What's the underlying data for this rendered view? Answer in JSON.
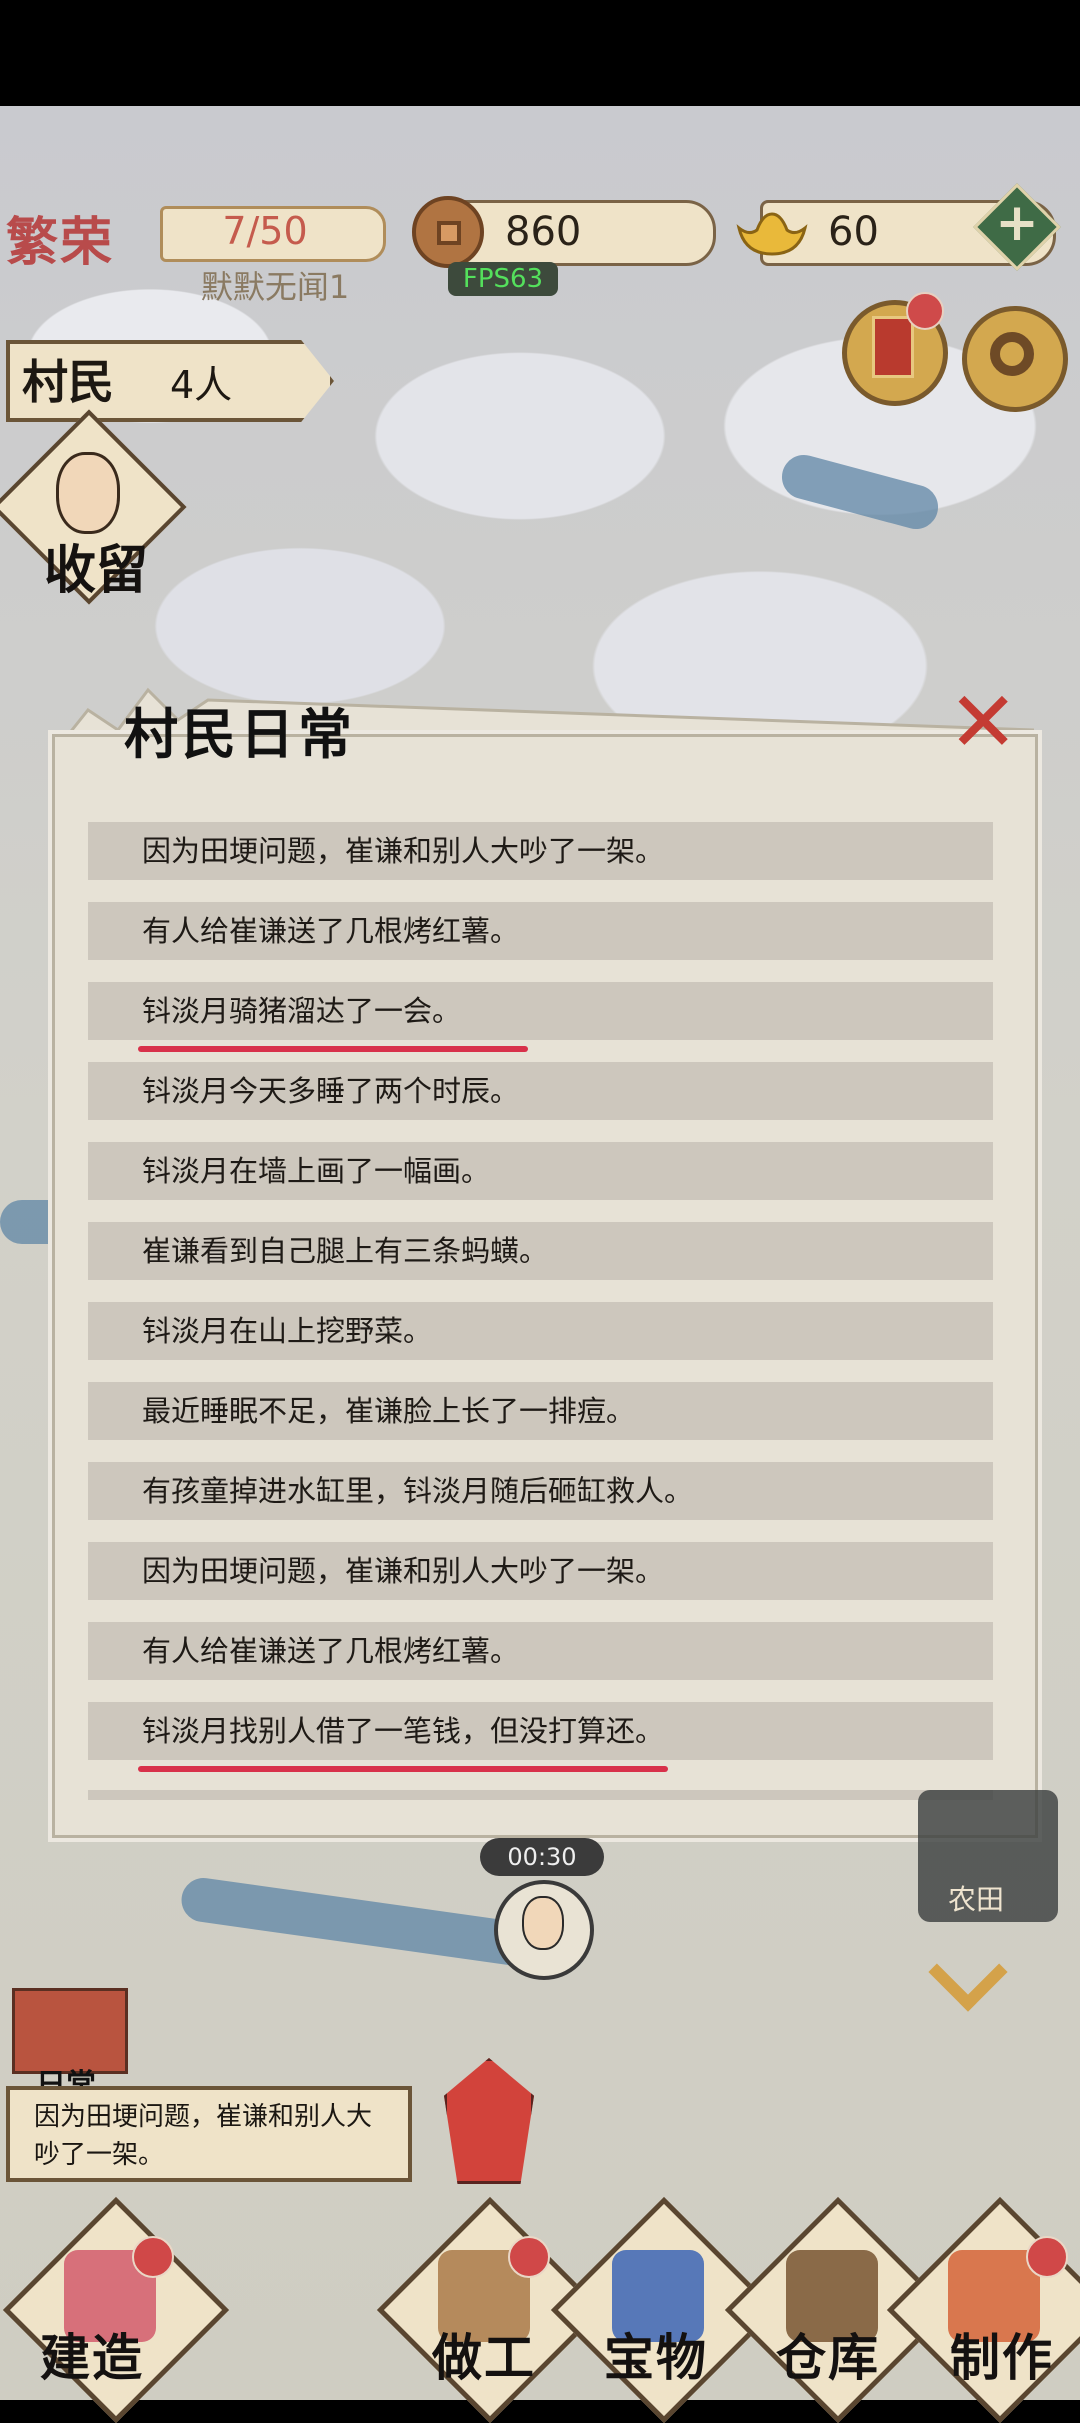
{
  "header": {
    "rank_title": "繁荣",
    "rank_count": "7/50",
    "rank_subtitle": "默默无闻1",
    "coins": "860",
    "gold": "60",
    "fps": "FPS63",
    "villager_label": "村民",
    "villager_count": "4人",
    "plus_glyph": "+"
  },
  "side": {
    "shelter_label": "收留"
  },
  "dialog": {
    "title": "村民日常",
    "close_glyph": "✕",
    "logs": [
      "因为田埂问题，崔谦和别人大吵了一架。",
      "有人给崔谦送了几根烤红薯。",
      "钭淡月骑猪溜达了一会。",
      "钭淡月今天多睡了两个时辰。",
      "钭淡月在墙上画了一幅画。",
      "崔谦看到自己腿上有三条蚂蟥。",
      "钭淡月在山上挖野菜。",
      "最近睡眠不足，崔谦脸上长了一排痘。",
      "有孩童掉进水缸里，钭淡月随后砸缸救人。",
      "因为田埂问题，崔谦和别人大吵了一架。",
      "有人给崔谦送了几根烤红薯。",
      "钭淡月找别人借了一笔钱，但没打算还。"
    ]
  },
  "map": {
    "timer": "00:30",
    "farm_label": "农田"
  },
  "daily": {
    "label": "日常",
    "text": "因为田埂问题，崔谦和别人大吵了一架。"
  },
  "nav": {
    "build": "建造",
    "work": "做工",
    "treasure": "宝物",
    "warehouse": "仓库",
    "craft": "制作"
  },
  "colors": {
    "highlight_underline": "#d8314a",
    "panel_bg": "#e7e2d6",
    "row_bg": "#cdc7bd"
  }
}
